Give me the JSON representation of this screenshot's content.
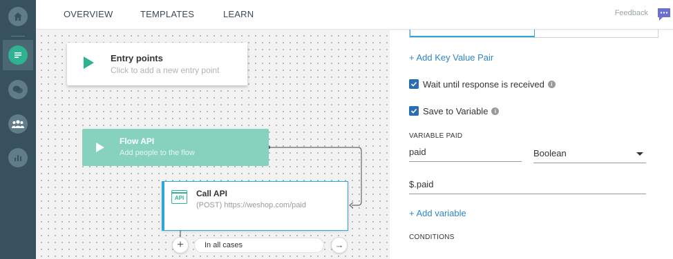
{
  "sidebar": {
    "items": [
      {
        "icon": "home-icon",
        "active": false
      },
      {
        "icon": "flows-chat-icon",
        "active": true
      },
      {
        "icon": "conversations-icon",
        "active": false
      },
      {
        "icon": "contacts-icon",
        "active": false
      },
      {
        "icon": "analytics-icon",
        "active": false
      }
    ]
  },
  "topbar": {
    "tabs": [
      "OVERVIEW",
      "TEMPLATES",
      "LEARN"
    ],
    "feedback": "Feedback"
  },
  "canvas": {
    "entry": {
      "title": "Entry points",
      "subtitle": "Click to add a new entry point"
    },
    "flow_api": {
      "title": "Flow API",
      "subtitle": "Add people to the flow"
    },
    "call_api": {
      "icon_text": "API",
      "title": "Call API",
      "subtitle": "(POST) https://weshop.com/paid"
    },
    "cases": {
      "add": "+",
      "label": "In all cases",
      "next": "→"
    }
  },
  "panel": {
    "add_key_value": "+ Add Key Value Pair",
    "wait_label": "Wait until response is received",
    "wait_checked": true,
    "save_label": "Save to Variable",
    "save_checked": true,
    "variable_section": "VARIABLE PAID",
    "variable_name": "paid",
    "variable_type": "Boolean",
    "variable_path": "$.paid",
    "add_variable": "+ Add variable",
    "conditions": "CONDITIONS"
  },
  "colors": {
    "sidebar": "#37525e",
    "accent_green": "#2fb291",
    "flow_card": "#87d2bf",
    "link_blue": "#2c86c8",
    "checkbox_blue": "#2a6db0",
    "selected_border": "#2ea8d6"
  }
}
